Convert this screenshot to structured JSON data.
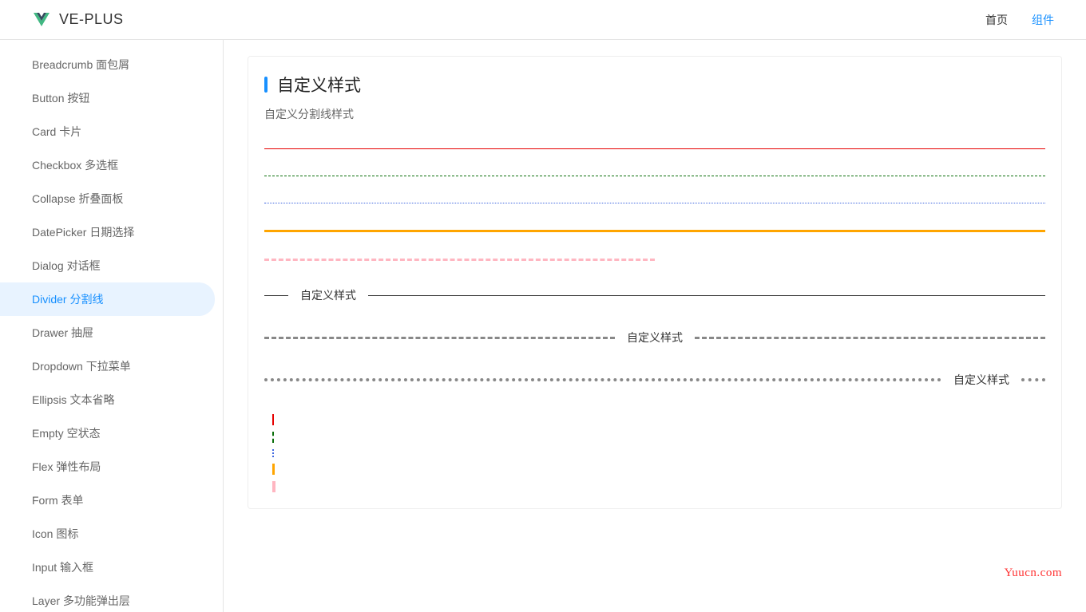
{
  "header": {
    "brand": "VE-PLUS",
    "nav": {
      "home": "首页",
      "components": "组件"
    }
  },
  "sidebar": {
    "items": [
      {
        "label": "Breadcrumb 面包屑",
        "active": false
      },
      {
        "label": "Button 按钮",
        "active": false
      },
      {
        "label": "Card 卡片",
        "active": false
      },
      {
        "label": "Checkbox 多选框",
        "active": false
      },
      {
        "label": "Collapse 折叠面板",
        "active": false
      },
      {
        "label": "DatePicker 日期选择",
        "active": false
      },
      {
        "label": "Dialog 对话框",
        "active": false
      },
      {
        "label": "Divider 分割线",
        "active": true
      },
      {
        "label": "Drawer 抽屉",
        "active": false
      },
      {
        "label": "Dropdown 下拉菜单",
        "active": false
      },
      {
        "label": "Ellipsis 文本省略",
        "active": false
      },
      {
        "label": "Empty 空状态",
        "active": false
      },
      {
        "label": "Flex 弹性布局",
        "active": false
      },
      {
        "label": "Form 表单",
        "active": false
      },
      {
        "label": "Icon 图标",
        "active": false
      },
      {
        "label": "Input 输入框",
        "active": false
      },
      {
        "label": "Layer 多功能弹出层",
        "active": false
      }
    ]
  },
  "content": {
    "title": "自定义样式",
    "subtitle": "自定义分割线样式",
    "divider_text_1": "自定义样式",
    "divider_text_2": "自定义样式",
    "divider_text_3": "自定义样式"
  },
  "watermark": "Yuucn.com"
}
